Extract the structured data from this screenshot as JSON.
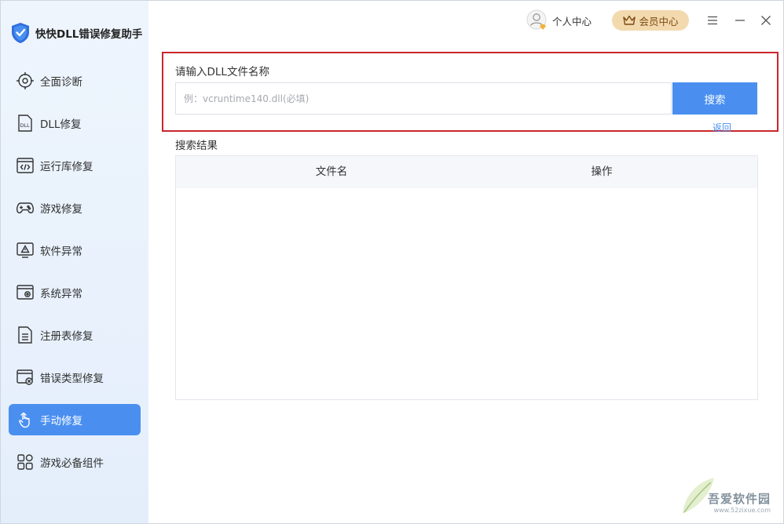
{
  "app": {
    "title": "快快DLL错误修复助手",
    "accent": "#4a8ff0",
    "alert_border": "#c9262b"
  },
  "topbar": {
    "user_center": "个人中心",
    "vip_center": "会员中心"
  },
  "sidebar": {
    "items": [
      {
        "label": "全面诊断",
        "icon": "target-scan-icon"
      },
      {
        "label": "DLL修复",
        "icon": "dll-file-icon"
      },
      {
        "label": "运行库修复",
        "icon": "code-window-icon"
      },
      {
        "label": "游戏修复",
        "icon": "gamepad-icon"
      },
      {
        "label": "软件异常",
        "icon": "warning-monitor-icon"
      },
      {
        "label": "系统异常",
        "icon": "system-settings-icon"
      },
      {
        "label": "注册表修复",
        "icon": "registry-list-icon"
      },
      {
        "label": "错误类型修复",
        "icon": "error-window-icon"
      },
      {
        "label": "手动修复",
        "icon": "hand-pointer-icon",
        "active": true
      },
      {
        "label": "游戏必备组件",
        "icon": "grid-components-icon"
      }
    ]
  },
  "search": {
    "label": "请输入DLL文件名称",
    "placeholder": "例：vcruntime140.dll(必填)",
    "value": "",
    "button": "搜索",
    "back": "返回"
  },
  "results": {
    "label": "搜索结果",
    "columns": [
      "文件名",
      "操作"
    ],
    "rows": []
  },
  "watermark": {
    "site_name": "吾爱软件园",
    "url": "www.52zixue.com"
  }
}
